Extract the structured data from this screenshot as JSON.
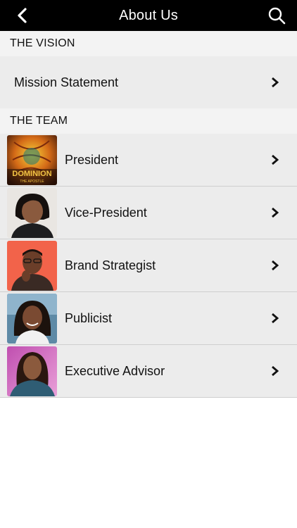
{
  "header": {
    "title": "About Us"
  },
  "sections": [
    {
      "title": "THE VISION",
      "items": [
        {
          "label": "Mission Statement"
        }
      ]
    },
    {
      "title": "THE TEAM",
      "items": [
        {
          "label": "President",
          "thumb_text": "DOMINION",
          "thumb_subtext": "THE APOSTLE"
        },
        {
          "label": "Vice-President"
        },
        {
          "label": "Brand Strategist"
        },
        {
          "label": "Publicist"
        },
        {
          "label": "Executive Advisor"
        }
      ]
    }
  ],
  "icons": {
    "back": "chevron-left-icon",
    "search": "search-icon",
    "row_arrow": "chevron-right-icon"
  },
  "colors": {
    "topbar": "#000000",
    "row_bg": "#ececec",
    "section_bg": "#f3f3f3"
  }
}
